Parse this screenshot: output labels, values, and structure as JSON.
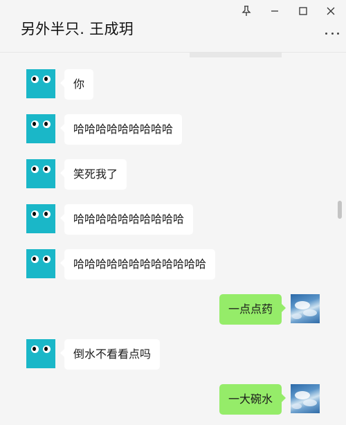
{
  "window": {
    "title": "另外半只. 王成玥",
    "controls": [
      "pin-icon",
      "minimize-icon",
      "maximize-icon",
      "close-icon"
    ],
    "more_icon": "more-dots-icon"
  },
  "colors": {
    "background": "#f5f5f5",
    "incoming_bubble": "#ffffff",
    "outgoing_bubble": "#95ec69",
    "contact_avatar": "#1ab7c8"
  },
  "messages": [
    {
      "side": "in",
      "text": "你"
    },
    {
      "side": "in",
      "text": "哈哈哈哈哈哈哈哈哈"
    },
    {
      "side": "in",
      "text": "笑死我了"
    },
    {
      "side": "in",
      "text": "哈哈哈哈哈哈哈哈哈哈"
    },
    {
      "side": "in",
      "text": "哈哈哈哈哈哈哈哈哈哈哈哈"
    },
    {
      "side": "out",
      "text": "一点点药"
    },
    {
      "side": "in",
      "text": "倒水不看看点吗"
    },
    {
      "side": "out",
      "text": "一大碗水"
    }
  ]
}
